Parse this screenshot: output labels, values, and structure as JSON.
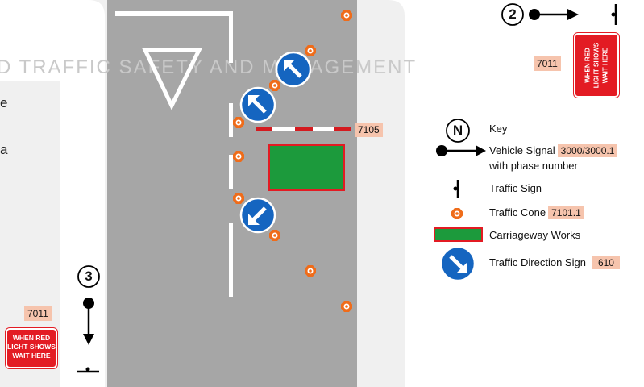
{
  "watermark": {
    "text": "D TRAFFIC SAFETY AND MANAGEMENT"
  },
  "left_panel": {
    "fragment_1": "e",
    "fragment_2": "a"
  },
  "signal_2": {
    "number": "2"
  },
  "signal_3": {
    "number": "3"
  },
  "signs": {
    "red_sign_lines": [
      "WHEN RED",
      "LIGHT SHOWS",
      "WAIT HERE"
    ],
    "red_sign_top_tag": "7011",
    "red_sign_bottom_tag": "7011"
  },
  "road": {
    "barrier_tag": "7105"
  },
  "key": {
    "north": "N",
    "title": "Key",
    "vehicle_signal": "Vehicle Signal",
    "vehicle_signal_tag": "3000/3000.1",
    "vehicle_signal_sub": "with phase number",
    "traffic_sign": "Traffic Sign",
    "traffic_cone": "Traffic Cone",
    "traffic_cone_tag": "7101.1",
    "carriageway_works": "Carriageway Works",
    "direction_sign": "Traffic Direction Sign",
    "direction_sign_tag": "610"
  },
  "colors": {
    "road": "#a6a6a6",
    "panel": "#f0f0f0",
    "sign_red": "#e31b23",
    "sign_blue": "#1565c0",
    "works_green": "#1c9a3c",
    "tag_bg": "#f6c4ad"
  }
}
